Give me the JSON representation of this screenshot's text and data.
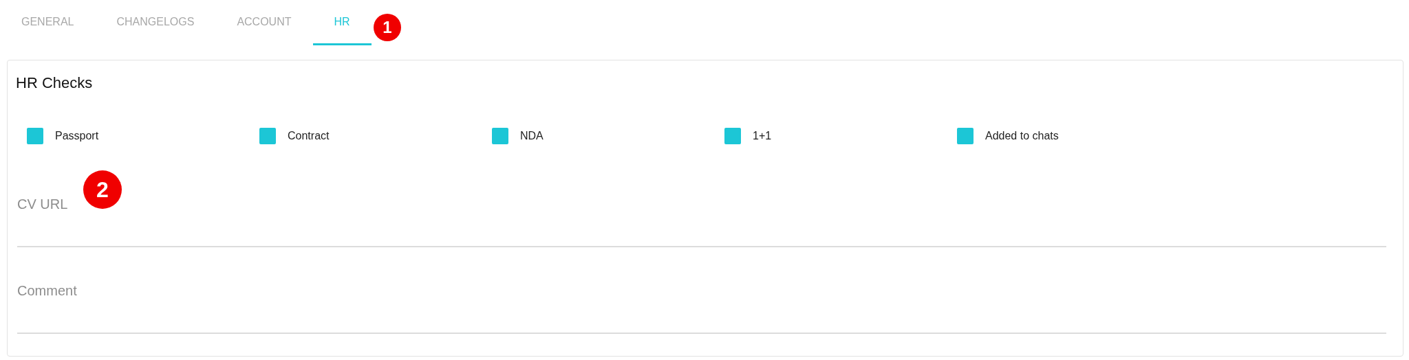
{
  "tabs": [
    {
      "label": "GENERAL",
      "selected": false
    },
    {
      "label": "CHANGELOGS",
      "selected": false
    },
    {
      "label": "ACCOUNT",
      "selected": false
    },
    {
      "label": "HR",
      "selected": true
    }
  ],
  "card": {
    "title": "HR Checks",
    "checks": [
      {
        "label": "Passport",
        "checked": true
      },
      {
        "label": "Contract",
        "checked": true
      },
      {
        "label": "NDA",
        "checked": true
      },
      {
        "label": "1+1",
        "checked": true
      },
      {
        "label": "Added to chats",
        "checked": true
      }
    ],
    "fields": [
      {
        "placeholder": "CV URL"
      },
      {
        "placeholder": "Comment"
      }
    ]
  },
  "markers": [
    {
      "label": "1"
    },
    {
      "label": "2"
    }
  ]
}
